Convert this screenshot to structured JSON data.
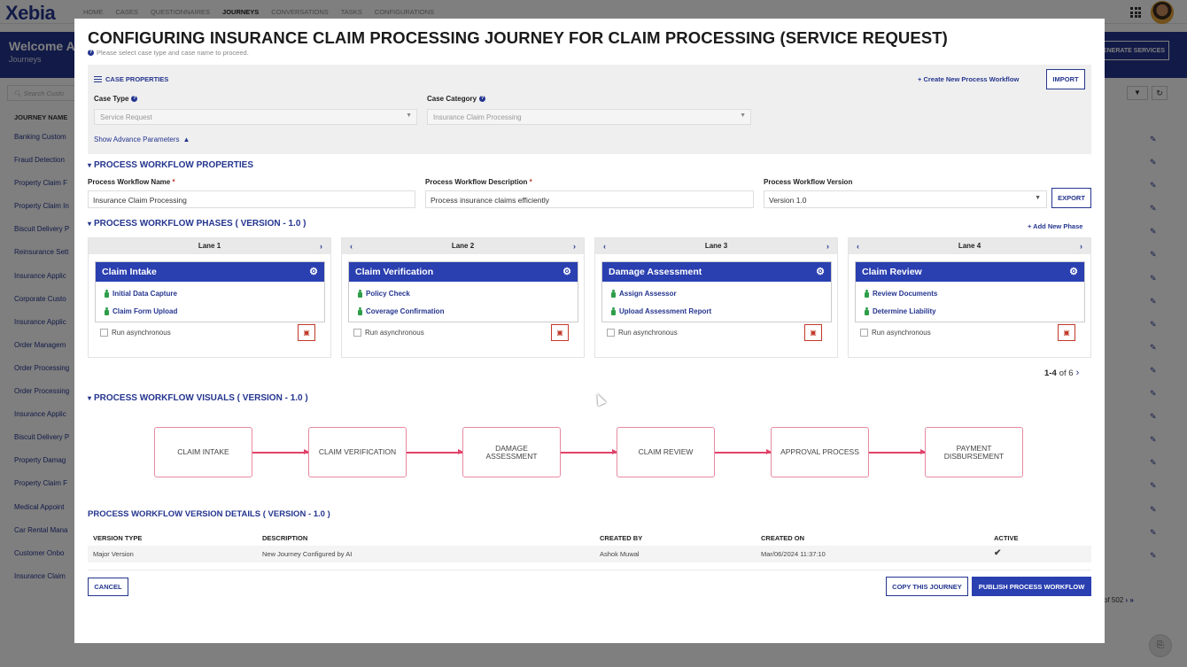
{
  "app": {
    "logo": "Xebia",
    "nav": [
      "HOME",
      "CASES",
      "QUESTIONNAIRES",
      "JOURNEYS",
      "CONVERSATIONS",
      "TASKS",
      "CONFIGURATIONS"
    ],
    "active_nav": "JOURNEYS",
    "banner_title": "Welcome A",
    "banner_sub": "Journeys",
    "generate_btn": "ENERATE SERVICES",
    "search_placeholder": "Search Custo",
    "col_head": "JOURNEY NAME",
    "rows": [
      "Banking Custom",
      "Fraud Detection",
      "Property Claim F",
      "Property Claim In",
      "Biscuit Delivery P",
      "Reinsurance Sett",
      "Insurance Applic",
      "Corporate Custo",
      "Insurance Applic",
      "Order Managem",
      "Order Processing",
      "Order Processing",
      "Insurance Applic",
      "Biscuit Delivery P",
      "Property Damag",
      "Property Claim F",
      "Medical Appoint",
      "Car Rental Mana",
      "Customer Onbo",
      "Insurance Claim"
    ],
    "pagination": "of 502"
  },
  "modal": {
    "title": "CONFIGURING INSURANCE CLAIM PROCESSING JOURNEY FOR CLAIM PROCESSING (SERVICE REQUEST)",
    "hint": "Please select case type and case name to proceed.",
    "case_properties": {
      "title": "CASE PROPERTIES",
      "create_link": "+ Create New Process Workflow",
      "import_btn": "IMPORT",
      "case_type_label": "Case Type",
      "case_type_value": "Service Request",
      "case_category_label": "Case Category",
      "case_category_value": "Insurance Claim Processing",
      "advance_link": "Show Advance Parameters"
    },
    "workflow_props": {
      "title": "PROCESS WORKFLOW PROPERTIES",
      "name_label": "Process Workflow Name",
      "name_value": "Insurance Claim Processing",
      "desc_label": "Process Workflow Description",
      "desc_value": "Process insurance claims efficiently",
      "version_label": "Process Workflow Version",
      "version_value": "Version 1.0",
      "export_btn": "EXPORT"
    },
    "phases": {
      "title": "PROCESS WORKFLOW PHASES ( VERSION - 1.0 )",
      "add_link": "+ Add New Phase",
      "async_label": "Run asynchronous",
      "lanes": [
        {
          "lane": "Lane 1",
          "phase": "Claim Intake",
          "tasks": [
            "Initial Data Capture",
            "Claim Form Upload"
          ]
        },
        {
          "lane": "Lane 2",
          "phase": "Claim Verification",
          "tasks": [
            "Policy Check",
            "Coverage Confirmation"
          ]
        },
        {
          "lane": "Lane 3",
          "phase": "Damage Assessment",
          "tasks": [
            "Assign Assessor",
            "Upload Assessment Report"
          ]
        },
        {
          "lane": "Lane 4",
          "phase": "Claim Review",
          "tasks": [
            "Review Documents",
            "Determine Liability"
          ]
        }
      ],
      "pager_range": "1-4",
      "pager_total": "of 6"
    },
    "visuals": {
      "title": "PROCESS WORKFLOW VISUALS ( VERSION - 1.0 )",
      "boxes": [
        "CLAIM INTAKE",
        "CLAIM VERIFICATION",
        "DAMAGE ASSESSMENT",
        "CLAIM REVIEW",
        "APPROVAL PROCESS",
        "PAYMENT DISBURSEMENT"
      ]
    },
    "version_details": {
      "title": "PROCESS WORKFLOW VERSION DETAILS ( VERSION - 1.0 )",
      "headers": [
        "VERSION TYPE",
        "DESCRIPTION",
        "CREATED BY",
        "CREATED ON",
        "ACTIVE"
      ],
      "row": [
        "Major Version",
        "New Journey Configured by AI",
        "Ashok Muwal",
        "Mar/06/2024 11:37:10"
      ]
    },
    "footer": {
      "cancel": "CANCEL",
      "copy": "COPY THIS JOURNEY",
      "publish": "PUBLISH PROCESS WORKFLOW"
    }
  },
  "colors": {
    "brand": "#24358f",
    "phase_header": "#2a3fb0",
    "flow_border": "#e78aa0",
    "success": "#2e9e49",
    "danger": "#c0392b"
  }
}
